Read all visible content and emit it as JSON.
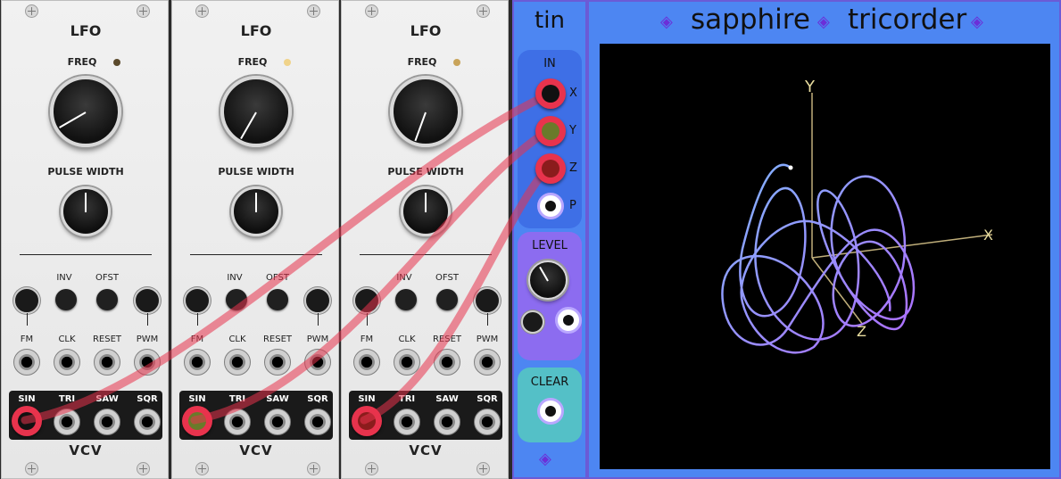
{
  "lfo_modules": [
    {
      "title": "LFO",
      "freq_label": "FREQ",
      "pw_label": "PULSE WIDTH",
      "led_color": "#5b4a2c",
      "controls": {
        "inv": "INV",
        "ofst": "OFST"
      },
      "inputs": [
        "FM",
        "CLK",
        "RESET",
        "PWM"
      ],
      "outputs": [
        "SIN",
        "TRI",
        "SAW",
        "SQR"
      ],
      "brand": "VCV"
    },
    {
      "title": "LFO",
      "freq_label": "FREQ",
      "pw_label": "PULSE WIDTH",
      "led_color": "#f0d38a",
      "controls": {
        "inv": "INV",
        "ofst": "OFST"
      },
      "inputs": [
        "FM",
        "CLK",
        "RESET",
        "PWM"
      ],
      "outputs": [
        "SIN",
        "TRI",
        "SAW",
        "SQR"
      ],
      "brand": "VCV"
    },
    {
      "title": "LFO",
      "freq_label": "FREQ",
      "pw_label": "PULSE WIDTH",
      "led_color": "#c9a45a",
      "controls": {
        "inv": "INV",
        "ofst": "OFST"
      },
      "inputs": [
        "FM",
        "CLK",
        "RESET",
        "PWM"
      ],
      "outputs": [
        "SIN",
        "TRI",
        "SAW",
        "SQR"
      ],
      "brand": "VCV"
    }
  ],
  "tin": {
    "title": "tin",
    "in_label": "IN",
    "ports": [
      "X",
      "Y",
      "Z",
      "P"
    ],
    "level_label": "LEVEL",
    "clear_label": "CLEAR",
    "logo_icon": "gem-icon"
  },
  "tricorder": {
    "title_left": "sapphire",
    "title_right": "tricorder",
    "axis_y": "Y",
    "axis_x": "X",
    "axis_z": "Z"
  },
  "colors": {
    "panel_blue": "#4d86f2",
    "cable_red": "#e8334d",
    "trace_start": "#7fb6ff",
    "trace_end": "#b06bff"
  },
  "icons": {
    "screw": "screw-icon",
    "gem": "gem-icon"
  }
}
